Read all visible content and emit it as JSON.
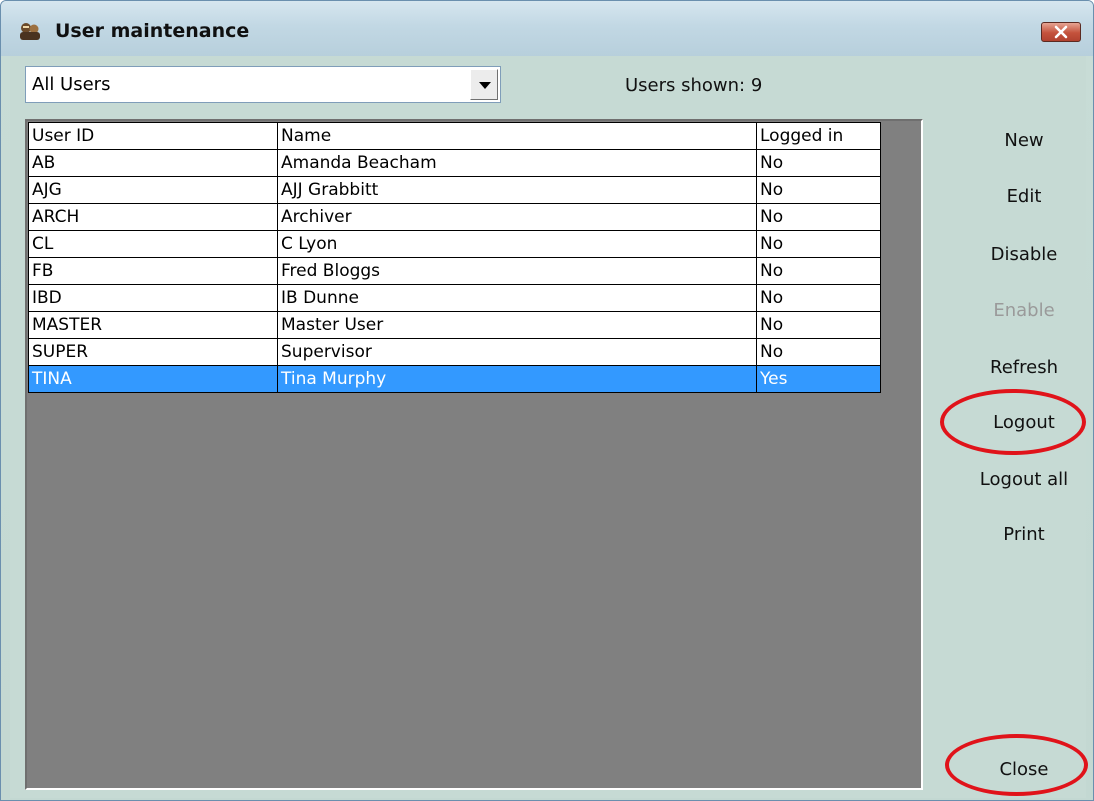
{
  "window": {
    "title": "User maintenance",
    "icon": "app-icon",
    "close_icon": "close-x-icon"
  },
  "filter": {
    "selected": "All Users",
    "dropdown_icon": "chevron-down-icon"
  },
  "users_shown_label": "Users shown: 9",
  "table": {
    "columns": [
      "User ID",
      "Name",
      "Logged in"
    ],
    "rows": [
      [
        "AB",
        "Amanda Beacham",
        "No"
      ],
      [
        "AJG",
        "AJJ Grabbitt",
        "No"
      ],
      [
        "ARCH",
        "Archiver",
        "No"
      ],
      [
        "CL",
        "C Lyon",
        "No"
      ],
      [
        "FB",
        "Fred Bloggs",
        "No"
      ],
      [
        "IBD",
        "IB Dunne",
        "No"
      ],
      [
        "MASTER",
        "Master User",
        "No"
      ],
      [
        "SUPER",
        "Supervisor",
        "No"
      ],
      [
        "TINA",
        "Tina Murphy",
        "Yes"
      ]
    ],
    "selected_row": 8
  },
  "actions": {
    "new": "New",
    "edit": "Edit",
    "disable": "Disable",
    "enable": "Enable",
    "refresh": "Refresh",
    "logout": "Logout",
    "logout_all": "Logout all",
    "print": "Print",
    "close": "Close"
  },
  "colors": {
    "selection": "#3399ff",
    "annotation_circle": "#e0131a",
    "dialog_background": "#c6dad4"
  }
}
